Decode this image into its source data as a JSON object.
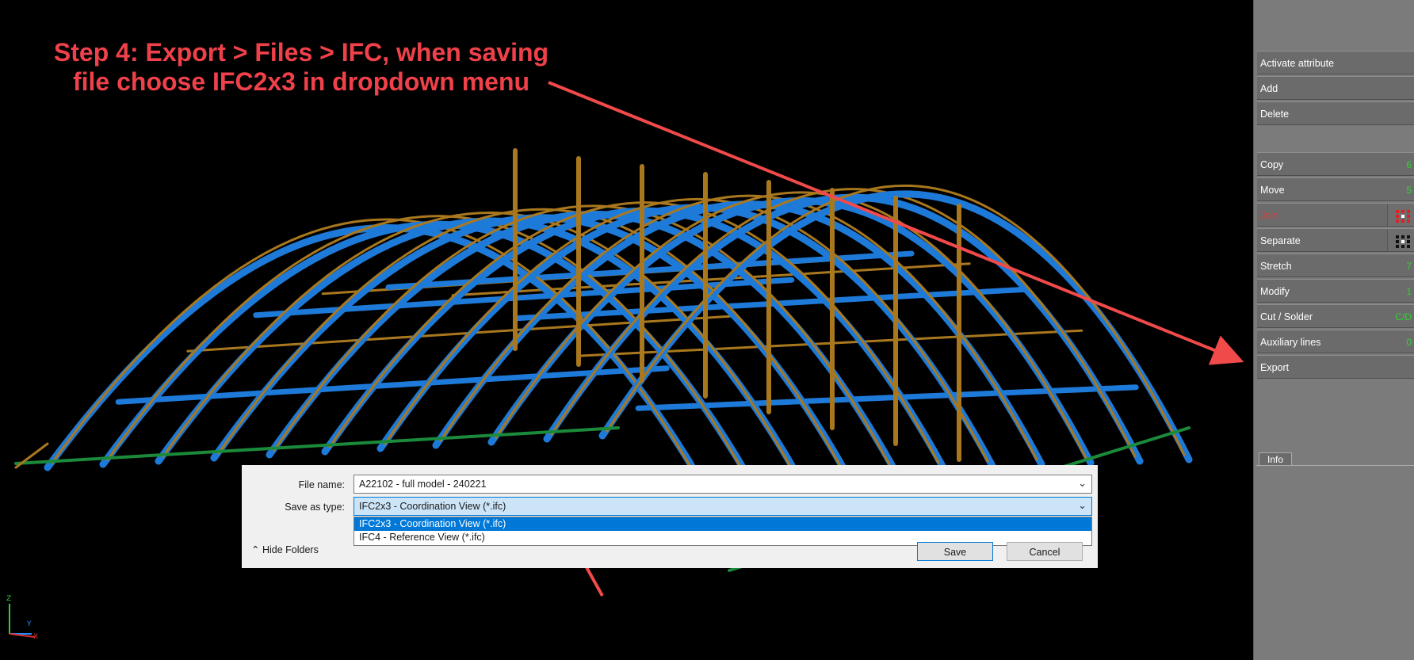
{
  "instruction": {
    "line1": "Step 4: Export > Files > IFC, when saving",
    "line2": "file choose IFC2x3 in dropdown menu"
  },
  "panel": {
    "commands": [
      {
        "label": "Activate attribute",
        "key": ""
      },
      {
        "label": "Add",
        "key": ""
      },
      {
        "label": "Delete",
        "key": ""
      },
      {
        "label": "Copy",
        "key": "6"
      },
      {
        "label": "Move",
        "key": "5"
      },
      {
        "label": "Join",
        "key": "",
        "disabled": true
      },
      {
        "label": "Separate",
        "key": ""
      },
      {
        "label": "Stretch",
        "key": "7"
      },
      {
        "label": "Modify",
        "key": "1"
      },
      {
        "label": "Cut / Solder",
        "key": "C/D"
      },
      {
        "label": "Auxiliary lines",
        "key": "0"
      },
      {
        "label": "Export",
        "key": ""
      }
    ],
    "info_tab": "Info"
  },
  "dialog": {
    "file_name_label": "File name:",
    "file_name_value": "A22102 - full model - 240221",
    "save_type_label": "Save as type:",
    "save_type_value": "IFC2x3 - Coordination View (*.ifc)",
    "options": [
      "IFC2x3 - Coordination View (*.ifc)",
      "IFC4 - Reference View (*.ifc)"
    ],
    "hide_folders": "Hide Folders",
    "save_button": "Save",
    "cancel_button": "Cancel"
  },
  "axes": {
    "z": "Z",
    "y": "Y",
    "x": "X"
  },
  "colors": {
    "annotation": "#f0414a",
    "arrow": "#f04a4a",
    "beam_blue": "#1e7ad8",
    "beam_gold": "#a9781e",
    "beam_green": "#1b8a3a",
    "highlight": "#0078d7",
    "key_green": "#32d232"
  }
}
